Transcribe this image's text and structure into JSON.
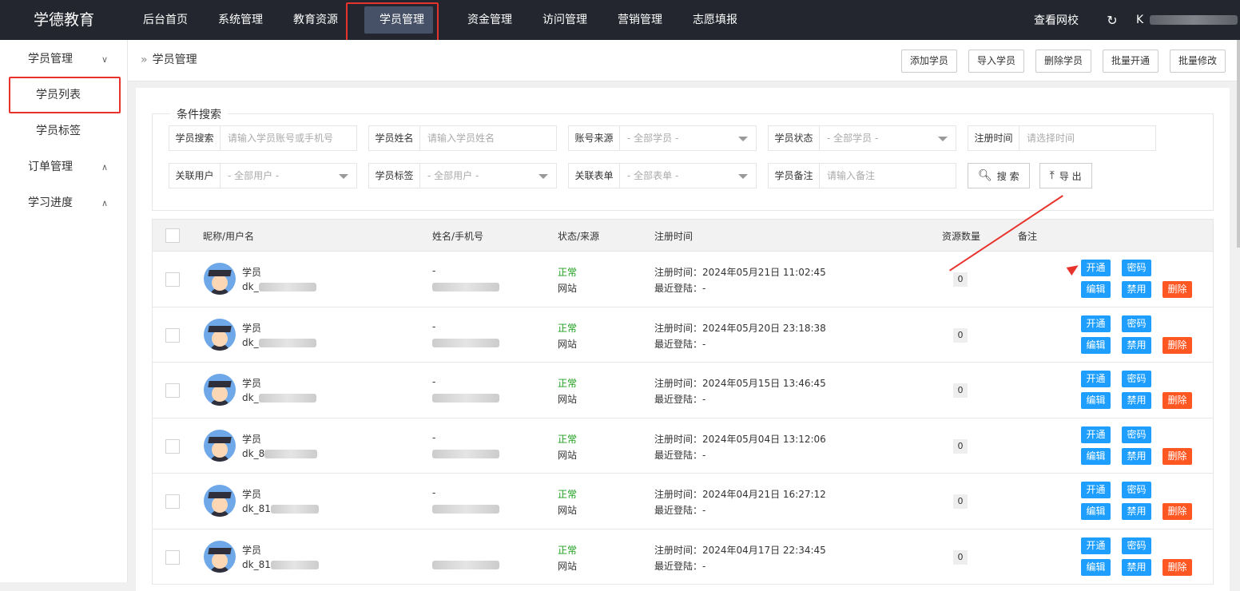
{
  "app": {
    "logo": "学德教育"
  },
  "nav": {
    "items": [
      "后台首页",
      "系统管理",
      "教育资源",
      "学员管理",
      "资金管理",
      "访问管理",
      "营销管理",
      "志愿填报"
    ],
    "active": "学员管理"
  },
  "top_right": {
    "view_school": "查看网校",
    "refresh_icon": "refresh-icon",
    "user_initial": "K"
  },
  "sidebar": {
    "items": [
      {
        "label": "学员管理",
        "expanded": true,
        "children": [
          "学员列表",
          "学员标签"
        ]
      },
      {
        "label": "订单管理",
        "expanded": false
      },
      {
        "label": "学习进度",
        "expanded": false
      }
    ],
    "active": "学员列表"
  },
  "breadcrumb": {
    "text": "学员管理"
  },
  "toolbar": {
    "add": "添加学员",
    "import": "导入学员",
    "delete": "删除学员",
    "batch_open": "批量开通",
    "batch_edit": "批量修改"
  },
  "search": {
    "legend": "条件搜索",
    "row1": [
      {
        "label": "学员搜索",
        "placeholder": "请输入学员账号或手机号"
      },
      {
        "label": "学员姓名",
        "placeholder": "请输入学员姓名"
      },
      {
        "label": "账号来源",
        "value": "- 全部学员 -"
      },
      {
        "label": "学员状态",
        "value": "- 全部学员 -"
      },
      {
        "label": "注册时间",
        "placeholder": "请选择时间"
      }
    ],
    "row2": [
      {
        "label": "关联用户",
        "value": "- 全部用户 -"
      },
      {
        "label": "学员标签",
        "value": "- 全部用户 -"
      },
      {
        "label": "关联表单",
        "value": "- 全部表单 -"
      },
      {
        "label": "学员备注",
        "placeholder": "请输入备注"
      }
    ],
    "search_btn": "搜 索",
    "export_btn": "导 出"
  },
  "table": {
    "headers": {
      "nickname": "昵称/用户名",
      "name": "姓名/手机号",
      "status": "状态/来源",
      "reg": "注册时间",
      "resource": "资源数量",
      "remark": "备注"
    },
    "rows": [
      {
        "nick": "学员",
        "user": "dk_",
        "name": "-",
        "status": "正常",
        "source": "网站",
        "reg": "注册时间：2024年05月21日 11:02:45",
        "last": "最近登陆：-",
        "res": "0"
      },
      {
        "nick": "学员",
        "user": "dk_",
        "name": "-",
        "status": "正常",
        "source": "网站",
        "reg": "注册时间：2024年05月20日 23:18:38",
        "last": "最近登陆：-",
        "res": "0"
      },
      {
        "nick": "学员",
        "user": "dk_",
        "name": "-",
        "status": "正常",
        "source": "网站",
        "reg": "注册时间：2024年05月15日 13:46:45",
        "last": "最近登陆：-",
        "res": "0"
      },
      {
        "nick": "学员",
        "user": "dk_8",
        "name": "-",
        "status": "正常",
        "source": "网站",
        "reg": "注册时间：2024年05月04日 13:12:06",
        "last": "最近登陆：-",
        "res": "0"
      },
      {
        "nick": "学员",
        "user": "dk_81",
        "name": "-",
        "status": "正常",
        "source": "网站",
        "reg": "注册时间：2024年04月21日 16:27:12",
        "last": "最近登陆：-",
        "res": "0"
      },
      {
        "nick": "学员",
        "user": "dk_81",
        "name": "",
        "status": "正常",
        "source": "网站",
        "reg": "注册时间：2024年04月17日 22:34:45",
        "last": "最近登陆：-",
        "res": "0"
      }
    ],
    "actions": {
      "open": "开通",
      "password": "密码",
      "edit": "编辑",
      "disable": "禁用",
      "delete": "删除"
    }
  }
}
